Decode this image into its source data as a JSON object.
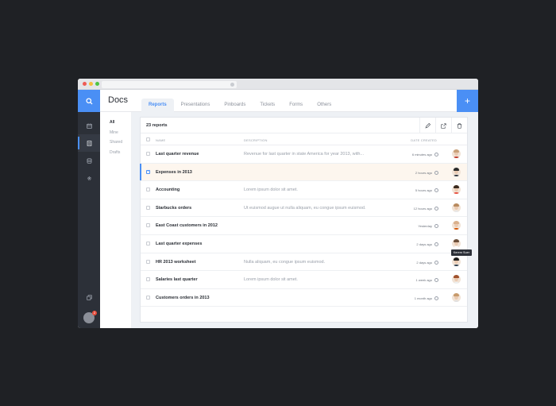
{
  "window": {
    "chrome_colors": [
      "#ee5c55",
      "#f5be3b",
      "#4fc443"
    ]
  },
  "rail": {
    "items": [
      {
        "icon": "calendar-icon",
        "active": false
      },
      {
        "icon": "document-icon",
        "active": true
      },
      {
        "icon": "database-icon",
        "active": false
      },
      {
        "icon": "gear-icon",
        "active": false
      }
    ],
    "bottom_icon": "pages-icon",
    "avatar_badge": "2"
  },
  "header": {
    "title": "Docs",
    "add_label": "+",
    "tabs": [
      {
        "label": "Reports",
        "active": true
      },
      {
        "label": "Presentations",
        "active": false
      },
      {
        "label": "Pinboards",
        "active": false
      },
      {
        "label": "Tickets",
        "active": false
      },
      {
        "label": "Forms",
        "active": false
      },
      {
        "label": "Others",
        "active": false
      }
    ]
  },
  "subnav": {
    "items": [
      {
        "label": "All",
        "active": true
      },
      {
        "label": "Mine",
        "active": false
      },
      {
        "label": "Shared",
        "active": false
      },
      {
        "label": "Drafts",
        "active": false
      }
    ]
  },
  "table": {
    "count_label": "23 reports",
    "actions": [
      "edit-icon",
      "share-icon",
      "delete-icon"
    ],
    "columns": {
      "name": "NAME",
      "description": "DESCRIPTION",
      "date": "DATE CREATED"
    },
    "rows": [
      {
        "name": "Last quarter revenue",
        "description": "Revenue for last quarter in state America for year 2013, with...",
        "date": "6 minutes ago",
        "selected": false,
        "avatar": {
          "hair": "#c9a17a",
          "shirt": "#c0392b"
        }
      },
      {
        "name": "Expenses in 2013",
        "description": "",
        "date": "2 hours ago",
        "selected": true,
        "avatar": {
          "hair": "#2b2b2b",
          "shirt": "#2f3640"
        }
      },
      {
        "name": "Accounting",
        "description": "Lorem ipsum dolor sit amet.",
        "date": "5 hours ago",
        "selected": false,
        "avatar": {
          "hair": "#3a2a1e",
          "shirt": "#e74c3c"
        }
      },
      {
        "name": "Starbucks orders",
        "description": "Ut euismod augue ut nulla aliquam, eu congue ipsum euismod.",
        "date": "12 hours ago",
        "selected": false,
        "avatar": {
          "hair": "#b88a5e",
          "shirt": "#e8e8e8"
        }
      },
      {
        "name": "East Coast customers in 2012",
        "description": "",
        "date": "Yesterday",
        "selected": false,
        "avatar": {
          "hair": "#d9b08c",
          "shirt": "#d35400"
        }
      },
      {
        "name": "Last quarter expenses",
        "description": "",
        "date": "2 days ago",
        "selected": false,
        "avatar": {
          "hair": "#6b4f3a",
          "shirt": "#ffffff"
        }
      },
      {
        "name": "HR 2013 worksheet",
        "description": "Nulla aliquam, eu congue ipsum euismod.",
        "date": "2 days ago",
        "selected": false,
        "avatar": {
          "hair": "#1e1e1e",
          "shirt": "#2c3e50"
        }
      },
      {
        "name": "Salaries last quarter",
        "description": "Lorem ipsum dolor sit amet.",
        "date": "1 week ago",
        "selected": false,
        "avatar": {
          "hair": "#a0522d",
          "shirt": "#ecf0f1"
        }
      },
      {
        "name": "Customers orders in 2013",
        "description": "",
        "date": "1 month ago",
        "selected": false,
        "avatar": {
          "hair": "#c79a6b",
          "shirt": "#e0e0e0"
        }
      }
    ],
    "tooltip": {
      "text": "Kerem Suer",
      "row": 5
    }
  },
  "colors": {
    "accent": "#4a8ff5",
    "rail_bg": "#2c3038",
    "selected_row": "#fdf6ee"
  }
}
